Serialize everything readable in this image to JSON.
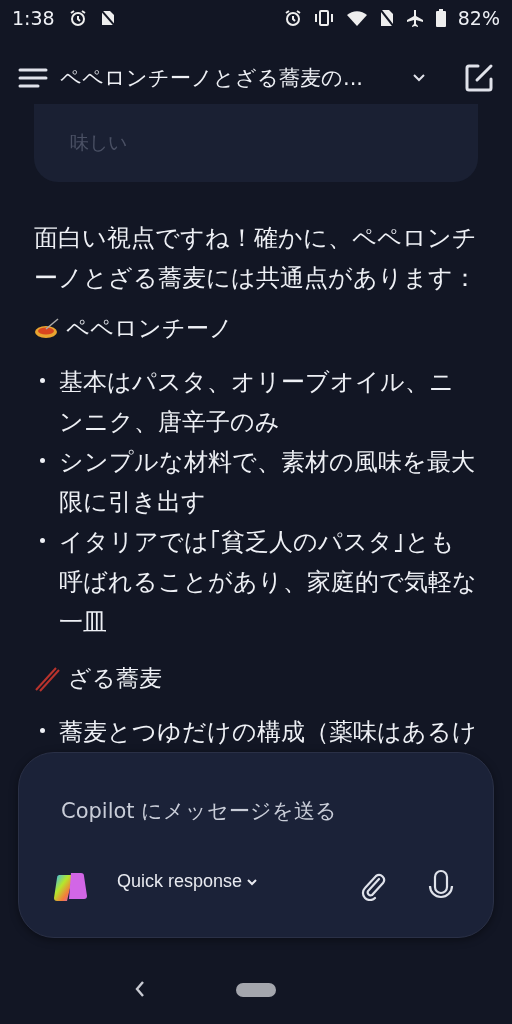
{
  "status_bar": {
    "time": "1:38",
    "battery": "82%"
  },
  "header": {
    "title": "ペペロンチーノとざる蕎麦の..."
  },
  "user_bubble": {
    "text": "味しい"
  },
  "response": {
    "intro": "面白い視点ですね！確かに、ペペロンチーノとざる蕎麦には共通点があります：",
    "sections": [
      {
        "kind": "pasta",
        "heading": "ペペロンチーノ",
        "bullets": [
          "基本はパスタ、オリーブオイル、ニンニク、唐辛子のみ",
          "シンプルな材料で、素材の風味を最大限に引き出す",
          "イタリアでは｢貧乏人のパスタ｣とも呼ばれることがあり、家庭的で気軽な一皿"
        ]
      },
      {
        "kind": "chopsticks",
        "heading": "ざる蕎麦",
        "bullets": [
          "蕎麦とつゆだけの構成（薬味はあるけ"
        ]
      }
    ]
  },
  "composer": {
    "placeholder": "Copilot にメッセージを送る",
    "mode": "Quick response"
  }
}
